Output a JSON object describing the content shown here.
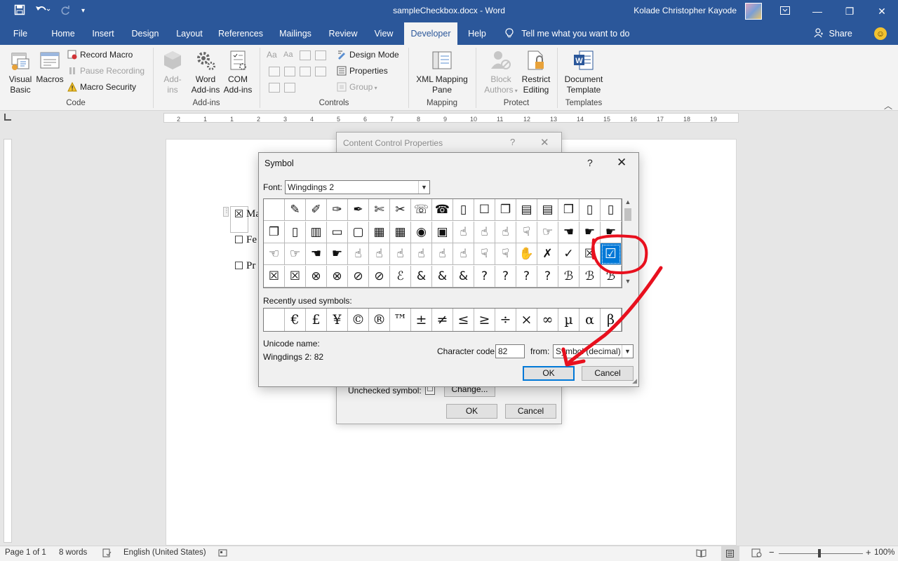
{
  "window": {
    "title": "sampleCheckbox.docx  -  Word",
    "user": "Kolade Christopher Kayode"
  },
  "tabs": [
    {
      "label": "File"
    },
    {
      "label": "Home"
    },
    {
      "label": "Insert"
    },
    {
      "label": "Design"
    },
    {
      "label": "Layout"
    },
    {
      "label": "References"
    },
    {
      "label": "Mailings"
    },
    {
      "label": "Review"
    },
    {
      "label": "View"
    },
    {
      "label": "Developer"
    },
    {
      "label": "Help"
    }
  ],
  "active_tab": "Developer",
  "tell_me": "Tell me what you want to do",
  "share": "Share",
  "ribbon": {
    "code": {
      "label": "Code",
      "visual_basic": [
        "Visual",
        "Basic"
      ],
      "macros": "Macros",
      "record_macro": "Record Macro",
      "pause_recording": "Pause Recording",
      "macro_security": "Macro Security"
    },
    "addins": {
      "label": "Add-ins",
      "addins": [
        "Add-",
        "ins"
      ],
      "word_addins": [
        "Word",
        "Add-ins"
      ],
      "com_addins": [
        "COM",
        "Add-ins"
      ]
    },
    "controls": {
      "label": "Controls",
      "design_mode": "Design Mode",
      "properties": "Properties",
      "group": "Group"
    },
    "mapping": {
      "label": "Mapping",
      "xml_pane": [
        "XML Mapping",
        "Pane"
      ]
    },
    "protect": {
      "label": "Protect",
      "block_authors": [
        "Block",
        "Authors"
      ],
      "restrict_editing": [
        "Restrict",
        "Editing"
      ]
    },
    "templates": {
      "label": "Templates",
      "document_template": [
        "Document",
        "Template"
      ]
    }
  },
  "ruler_numbers": [
    "2",
    "1",
    "1",
    "2",
    "3",
    "4",
    "5",
    "6",
    "7",
    "8",
    "9",
    "10",
    "11",
    "12",
    "13",
    "14",
    "15",
    "16",
    "17",
    "18",
    "19"
  ],
  "document": {
    "lines": [
      {
        "box": "☒",
        "text": "Ma"
      },
      {
        "box": "☐",
        "text": "Fe"
      },
      {
        "box": "☐",
        "text": "Pr"
      }
    ]
  },
  "ccp_dialog": {
    "title": "Content Control Properties",
    "help": "?",
    "unchecked_label": "Unchecked symbol:",
    "change_button": "Change...",
    "ok": "OK",
    "cancel": "Cancel"
  },
  "symbol_dialog": {
    "title": "Symbol",
    "help": "?",
    "font_label": "Font:",
    "font_value": "Wingdings 2",
    "symbol_rows": [
      [
        "",
        "✎",
        "✐",
        "✑",
        "✒",
        "✄",
        "✂",
        "☏",
        "☎",
        "▯",
        "☐",
        "❐",
        "▤",
        "▤",
        "❒",
        "▯",
        "▯"
      ],
      [
        "❐",
        "▯",
        "▥",
        "▭",
        "▢",
        "▦",
        "▦",
        "◉",
        "▣",
        "☝",
        "☝",
        "☝",
        "☟",
        "☞",
        "☚",
        "☛",
        "☛"
      ],
      [
        "☜",
        "☞",
        "☚",
        "☛",
        "☝",
        "☝",
        "☝",
        "☝",
        "☝",
        "☝",
        "☟",
        "☟",
        "✋",
        "✗",
        "✓",
        "☒",
        "☑"
      ],
      [
        "☒",
        "☒",
        "⊗",
        "⊗",
        "⊘",
        "⊘",
        "ℰ",
        "&",
        "&",
        "&",
        "?",
        "?",
        "?",
        "?",
        "ℬ",
        "ℬ",
        "ℬ"
      ]
    ],
    "selected_cell": [
      2,
      16
    ],
    "recent_label": "Recently used symbols:",
    "recent": [
      "",
      "€",
      "£",
      "¥",
      "©",
      "®",
      "™",
      "±",
      "≠",
      "≤",
      "≥",
      "÷",
      "×",
      "∞",
      "µ",
      "α",
      "β"
    ],
    "unicode_name_label": "Unicode name:",
    "unicode_name": "Wingdings 2: 82",
    "char_code_label": "Character code:",
    "char_code": "82",
    "from_label": "from:",
    "from_value": "Symbol (decimal)",
    "ok": "OK",
    "cancel": "Cancel"
  },
  "status": {
    "page": "Page 1 of 1",
    "words": "8 words",
    "language": "English (United States)",
    "zoom": "100%"
  },
  "annotation_color": "#e8101e"
}
